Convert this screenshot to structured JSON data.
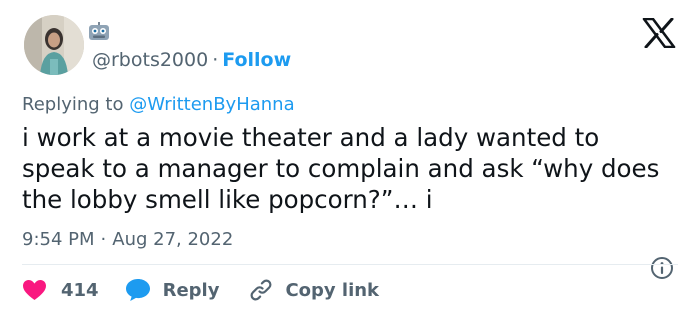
{
  "author": {
    "handle": "@rbots2000",
    "separator": "·",
    "follow_label": "Follow",
    "avatar_icon": "profile-photo",
    "badge_icon": "robot-icon"
  },
  "brand": {
    "logo_icon": "x-logo-icon"
  },
  "reply_context": {
    "prefix": "Replying to",
    "mention": "@WrittenByHanna"
  },
  "tweet": {
    "text": "i work at a movie theater and a lady wanted to speak to a manager to complain and ask “why does the lobby smell like popcorn?”… i"
  },
  "meta": {
    "time": "9:54 PM",
    "separator": "·",
    "date": "Aug 27, 2022",
    "info_icon": "info-icon"
  },
  "actions": {
    "likes_count": "414",
    "reply_label": "Reply",
    "copy_link_label": "Copy link"
  },
  "colors": {
    "accent": "#1d9bf0",
    "heart": "#f91880",
    "text": "#0f1419",
    "muted": "#536471",
    "divider": "#e6ecf0"
  }
}
